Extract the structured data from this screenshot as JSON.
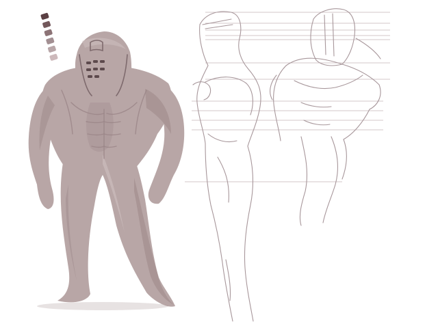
{
  "colors": {
    "background": "#ffffff",
    "body_fill": "#b8a6a6",
    "body_shade": "#9e8a8b",
    "body_light": "#cfc1c1",
    "line": "#a7969a",
    "guide": "#d3c7ca"
  },
  "swatches": [
    "#5b4043",
    "#73585b",
    "#8c7376",
    "#a28f92",
    "#b8a6a8",
    "#cdb9bb"
  ]
}
